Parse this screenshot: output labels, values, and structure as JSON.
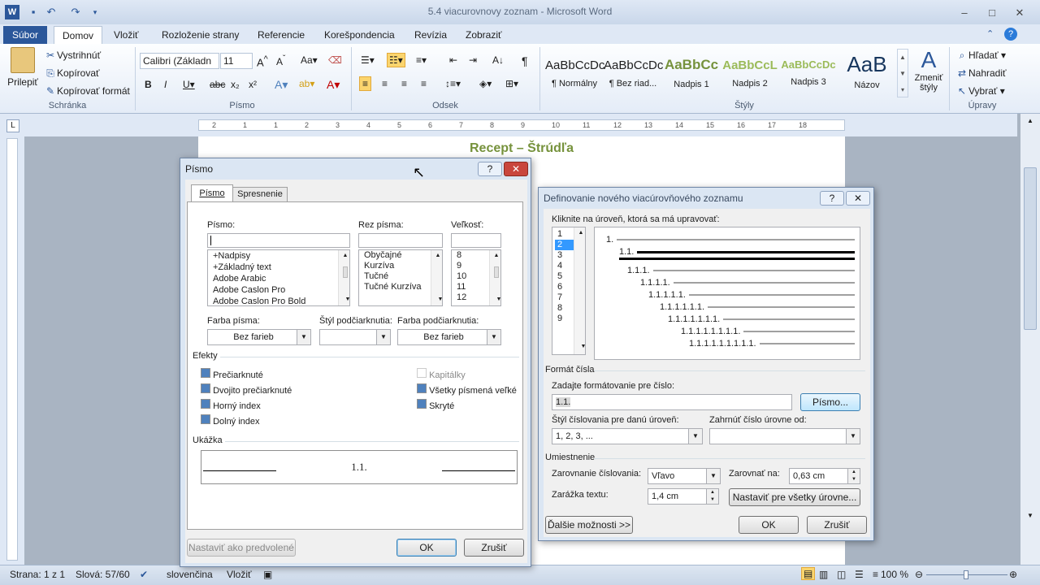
{
  "window": {
    "title": "5.4 viacurovnovy zoznam - Microsoft Word"
  },
  "tabs": [
    "Súbor",
    "Domov",
    "Vložiť",
    "Rozloženie strany",
    "Referencie",
    "Korešpondencia",
    "Revízia",
    "Zobraziť"
  ],
  "clipboard": {
    "paste": "Prilepiť",
    "cut": "Vystrihnúť",
    "copy": "Kopírovať",
    "format_painter": "Kopírovať formát",
    "label": "Schránka"
  },
  "font_group": {
    "font": "Calibri (Základn",
    "size": "11",
    "label": "Písmo"
  },
  "paragraph_group": {
    "label": "Odsek"
  },
  "styles": {
    "items": [
      {
        "preview": "AaBbCcDc",
        "name": "¶ Normálny"
      },
      {
        "preview": "AaBbCcDc",
        "name": "¶ Bez riad..."
      },
      {
        "preview": "AaBbCc",
        "name": "Nadpis 1"
      },
      {
        "preview": "AaBbCcL",
        "name": "Nadpis 2"
      },
      {
        "preview": "AaBbCcDc",
        "name": "Nadpis 3"
      },
      {
        "preview": "AaB",
        "name": "Názov"
      }
    ],
    "change": "Zmeniť štýly",
    "label": "Štýly"
  },
  "editing": {
    "find": "Hľadať",
    "replace": "Nahradiť",
    "select": "Vybrať",
    "label": "Úpravy"
  },
  "ruler": [
    "2",
    "1",
    "1",
    "2",
    "3",
    "4",
    "5",
    "6",
    "7",
    "8",
    "9",
    "10",
    "11",
    "12",
    "13",
    "14",
    "15",
    "16",
    "17",
    "18"
  ],
  "document": {
    "title": "Recept – Štrúdľa"
  },
  "status": {
    "page": "Strana: 1 z 1",
    "words": "Slová: 57/60",
    "language": "slovenčina",
    "mode": "Vložiť",
    "zoom": "100 %"
  },
  "font_dialog": {
    "title": "Písmo",
    "tabs": [
      "Písmo",
      "Spresnenie"
    ],
    "font_label": "Písmo:",
    "style_label": "Rez písma:",
    "size_label": "Veľkosť:",
    "fonts": [
      "+Nadpisy",
      "+Základný text",
      "Adobe Arabic",
      "Adobe Caslon Pro",
      "Adobe Caslon Pro Bold"
    ],
    "styles": [
      "Obyčajné",
      "Kurzíva",
      "Tučné",
      "Tučné Kurzíva"
    ],
    "sizes": [
      "8",
      "9",
      "10",
      "11",
      "12"
    ],
    "color_label": "Farba písma:",
    "color_value": "Bez farieb",
    "underline_label": "Štýl podčiarknutia:",
    "underline_value": "",
    "underline_color_label": "Farba podčiarknutia:",
    "underline_color_value": "Bez farieb",
    "effects_label": "Efekty",
    "effects_left": [
      "Prečiarknuté",
      "Dvojito prečiarknuté",
      "Horný index",
      "Dolný index"
    ],
    "effects_right": [
      "Kapitálky",
      "Všetky písmená veľké",
      "Skryté"
    ],
    "preview_label": "Ukážka",
    "preview_text": "1.1.",
    "set_default": "Nastaviť ako predvolené",
    "ok": "OK",
    "cancel": "Zrušiť"
  },
  "list_dialog": {
    "title": "Definovanie nového viacúrovňového zoznamu",
    "level_prompt": "Kliknite na úroveň, ktorá sa má upravovať:",
    "levels": [
      "1",
      "2",
      "3",
      "4",
      "5",
      "6",
      "7",
      "8",
      "9"
    ],
    "preview_numbers": [
      "1.",
      "1.1.",
      "1.1.1.",
      "1.1.1.1.",
      "1.1.1.1.1.",
      "1.1.1.1.1.1.",
      "1.1.1.1.1.1.1.",
      "1.1.1.1.1.1.1.1.",
      "1.1.1.1.1.1.1.1.1."
    ],
    "number_format_section": "Formát čísla",
    "format_prompt": "Zadajte formátovanie pre číslo:",
    "format_value": "1.1.",
    "font_button": "Písmo...",
    "style_label": "Štýl číslovania pre danú úroveň:",
    "style_value": "1, 2, 3, ...",
    "include_label": "Zahrnúť číslo úrovne od:",
    "include_value": "",
    "position_section": "Umiestnenie",
    "alignment_label": "Zarovnanie číslovania:",
    "alignment_value": "Vľavo",
    "align_at_label": "Zarovnať na:",
    "align_at_value": "0,63 cm",
    "indent_label": "Zarážka textu:",
    "indent_value": "1,4 cm",
    "set_all": "Nastaviť pre všetky úrovne...",
    "more": "Ďalšie možnosti >>",
    "ok": "OK",
    "cancel": "Zrušiť"
  }
}
